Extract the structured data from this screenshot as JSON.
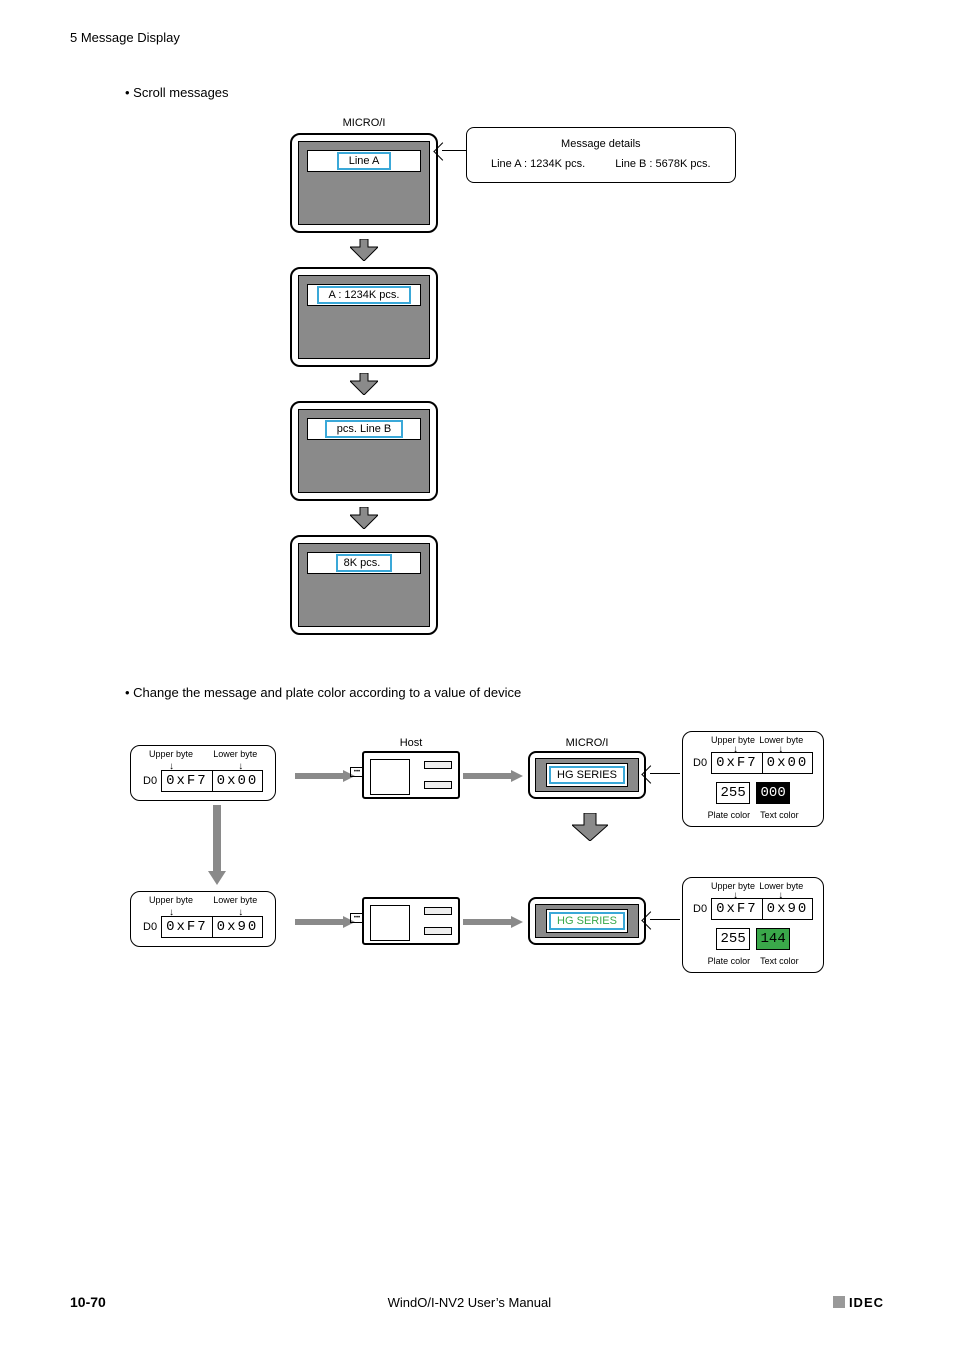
{
  "header": "5 Message Display",
  "bullet1": "• Scroll messages",
  "bullet2": "• Change the message and plate color according to a value of device",
  "microi_label": "MICRO/I",
  "host_label": "Host",
  "scroll": {
    "s1": "Line A",
    "s2": "A : 1234K pcs.",
    "s3": "pcs.    Line B",
    "s4": "8K pcs."
  },
  "callout": {
    "title": "Message details",
    "a": "Line A : 1234K pcs.",
    "b": "Line B : 5678K pcs."
  },
  "bytes": {
    "upper": "Upper byte",
    "lower": "Lower byte",
    "d0": "D0",
    "r1u": "0xF7",
    "r1l": "0x00",
    "r2u": "0xF7",
    "r2l": "0x90",
    "plate": "Plate color",
    "textc": "Text color",
    "sw1a": "255",
    "sw1b": "000",
    "sw2a": "255",
    "sw2b": "144"
  },
  "hmi2": {
    "t1": "HG SERIES",
    "t2": "HG SERIES"
  },
  "footer": {
    "page": "10-70",
    "manual": "WindO/I-NV2 User’s Manual",
    "brand": "IDEC"
  }
}
